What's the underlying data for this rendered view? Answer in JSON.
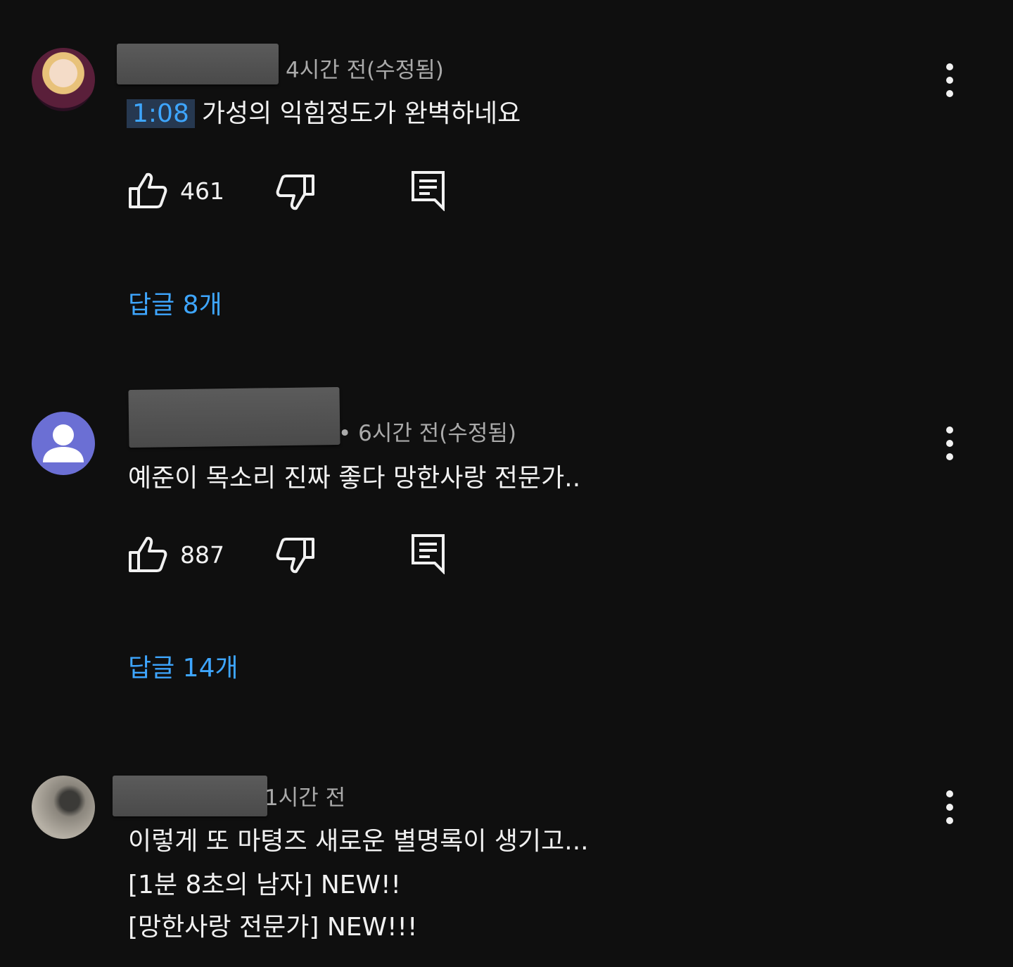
{
  "comments": [
    {
      "meta": "4시간 전(수정됨)",
      "timestamp": "1:08",
      "text": "가성의 익힘정도가 완벽하네요",
      "likes": "461",
      "replies": "답글 8개"
    },
    {
      "meta": "• 6시간 전(수정됨)",
      "text": "예준이 목소리 진짜 좋다 망한사랑 전문가..",
      "likes": "887",
      "replies": "답글 14개"
    },
    {
      "meta": "1시간 전",
      "lines": [
        "이렇게 또 마텽즈 새로운 별명록이 생기고...",
        "[1분 8초의 남자] NEW!!",
        "[망한사랑 전문가] NEW!!!"
      ]
    }
  ],
  "icons": {
    "like": "thumbs-up-icon",
    "dislike": "thumbs-down-icon",
    "reply": "reply-icon",
    "menu": "more-vertical-icon"
  },
  "colors": {
    "background": "#0f0f0f",
    "link": "#3ea6ff",
    "meta": "#aaaaaa",
    "text": "#f1f1f1"
  }
}
